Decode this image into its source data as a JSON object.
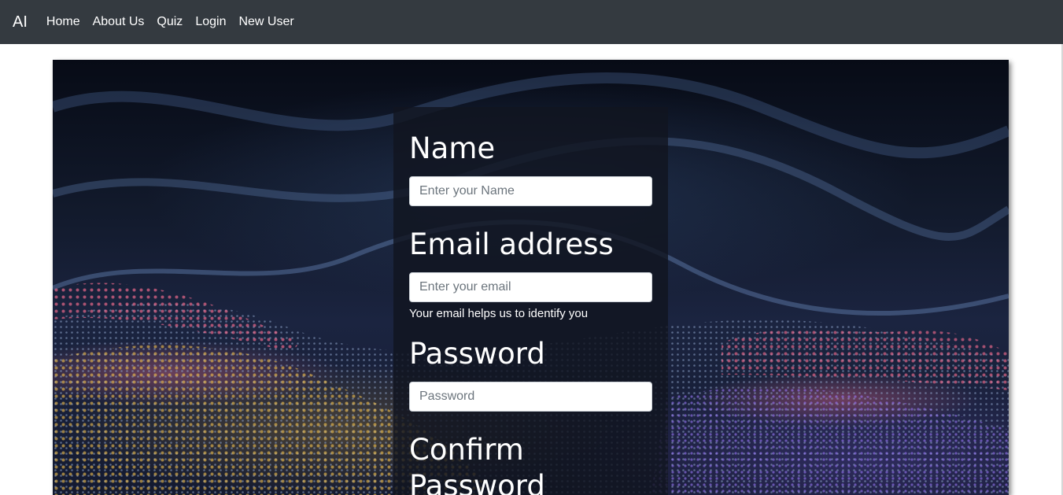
{
  "navbar": {
    "brand": "AI",
    "links": [
      "Home",
      "About Us",
      "Quiz",
      "Login",
      "New User"
    ]
  },
  "form": {
    "name": {
      "label": "Name",
      "placeholder": "Enter your Name"
    },
    "email": {
      "label": "Email address",
      "placeholder": "Enter your email",
      "help": "Your email helps us to identify you"
    },
    "password": {
      "label": "Password",
      "placeholder": "Password"
    },
    "confirm": {
      "label": "Confirm Password"
    }
  },
  "colors": {
    "navbar_bg": "#343a40",
    "panel_bg": "#111520"
  },
  "icons": {
    "hero": "abstract-particle-wave-background"
  }
}
